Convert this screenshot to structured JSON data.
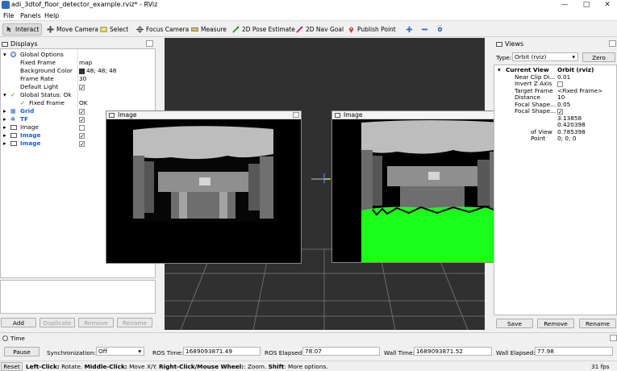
{
  "window": {
    "title": "adi_3dtof_floor_detector_example.rviz* - RViz"
  },
  "menu": [
    "File",
    "Panels",
    "Help"
  ],
  "toolbar": {
    "tools": [
      {
        "label": "Interact",
        "icon": "interact-icon",
        "active": true
      },
      {
        "label": "Move Camera",
        "icon": "move-camera-icon"
      },
      {
        "label": "Select",
        "icon": "select-icon"
      },
      {
        "label": "Focus Camera",
        "icon": "focus-camera-icon"
      },
      {
        "label": "Measure",
        "icon": "measure-icon"
      },
      {
        "label": "2D Pose Estimate",
        "icon": "pose-estimate-icon",
        "color": "#1aa01a"
      },
      {
        "label": "2D Nav Goal",
        "icon": "nav-goal-icon",
        "color": "#c2187a"
      },
      {
        "label": "Publish Point",
        "icon": "publish-point-icon",
        "color": "#d43a1a"
      }
    ]
  },
  "displays": {
    "title": "Displays",
    "global_options": {
      "label": "Global Options",
      "fixed_frame": {
        "key": "Fixed Frame",
        "value": "map"
      },
      "background_color": {
        "key": "Background Color",
        "value": "48; 48; 48",
        "swatch": "#303030"
      },
      "frame_rate": {
        "key": "Frame Rate",
        "value": "30"
      },
      "default_light": {
        "key": "Default Light",
        "checked": true
      }
    },
    "global_status": {
      "label": "Global Status: Ok",
      "fixed_frame": {
        "key": "Fixed Frame",
        "value": "OK"
      }
    },
    "items": [
      {
        "label": "Grid",
        "checked": true,
        "highlight": true
      },
      {
        "label": "TF",
        "checked": true,
        "highlight": true
      },
      {
        "label": "Image",
        "checked": false,
        "highlight": false
      },
      {
        "label": "Image",
        "checked": true,
        "highlight": true
      },
      {
        "label": "Image",
        "checked": true,
        "highlight": true
      }
    ],
    "buttons": {
      "add": "Add",
      "duplicate": "Duplicate",
      "remove": "Remove",
      "rename": "Rename"
    }
  },
  "image_windows": [
    {
      "title": "Image"
    },
    {
      "title": "Image"
    }
  ],
  "views": {
    "title": "Views",
    "type_label": "Type:",
    "type_value": "Orbit (rviz)",
    "zero": "Zero",
    "current_view": {
      "key": "Current View",
      "value": "Orbit (rviz)"
    },
    "props": [
      {
        "key": "Near Clip Di...",
        "value": "0.01"
      },
      {
        "key": "Invert Z Axis",
        "value": "",
        "checkbox": true,
        "checked": false
      },
      {
        "key": "Target Frame",
        "value": "<Fixed Frame>"
      },
      {
        "key": "Distance",
        "value": "10"
      },
      {
        "key": "Focal Shape...",
        "value": "0.05"
      },
      {
        "key": "Focal Shape...",
        "value": "",
        "checkbox": true,
        "checked": true
      },
      {
        "key": "",
        "value": "3.13858"
      },
      {
        "key": "",
        "value": "0.420398"
      },
      {
        "key": "of View",
        "value": "0.785398"
      },
      {
        "key": "Point",
        "value": "0; 0; 0"
      }
    ],
    "buttons": {
      "save": "Save",
      "remove": "Remove",
      "rename": "Rename"
    }
  },
  "time": {
    "title": "Time",
    "pause": "Pause",
    "sync_label": "Synchronization:",
    "sync_value": "Off",
    "ros_time_label": "ROS Time:",
    "ros_time": "1689093871.49",
    "ros_elapsed_label": "ROS Elapsed:",
    "ros_elapsed": "78.07",
    "wall_time_label": "Wall Time:",
    "wall_time": "1689093871.52",
    "wall_elapsed_label": "Wall Elapsed:",
    "wall_elapsed": "77.98"
  },
  "status": {
    "reset": "Reset",
    "hint_parts": [
      {
        "text": "Left-Click:",
        "bold": true
      },
      {
        "text": " Rotate. ",
        "bold": false
      },
      {
        "text": "Middle-Click:",
        "bold": true
      },
      {
        "text": " Move X/Y. ",
        "bold": false
      },
      {
        "text": "Right-Click/Mouse Wheel:",
        "bold": true
      },
      {
        "text": ": Zoom. ",
        "bold": false
      },
      {
        "text": "Shift",
        "bold": true
      },
      {
        "text": ": More options.",
        "bold": false
      }
    ],
    "fps": "31 fps"
  }
}
